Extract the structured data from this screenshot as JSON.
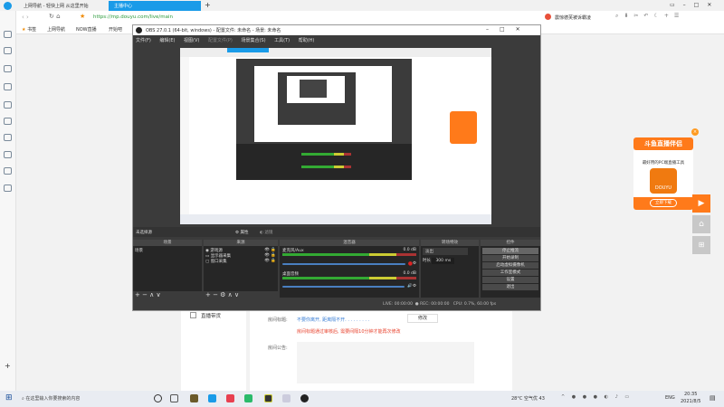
{
  "browser": {
    "tabs": [
      {
        "label": "上网导航 - 轻快上网 从这里开始",
        "active": false
      },
      {
        "label": "主播中心",
        "active": true
      }
    ],
    "url": "https://mp.douyu.com/live/main",
    "bookmarks": [
      "书签",
      "上网导航",
      "NOW直播",
      "开始吧"
    ],
    "hot_search": "震惊德芙被诉霸凌"
  },
  "page": {
    "nav_item": "直播带货",
    "title_label": "房间标题:",
    "title_value": "不要你离开, 距离隔不开. . . . . . . . .",
    "edit_button": "修改",
    "title_note": "房间标题通过审核后, 需要间隔10分钟才能再次修改",
    "notice_label": "房间公告:"
  },
  "ad": {
    "title": "斗鱼直播伴侣",
    "subtitle": "最好用的PC端直播工具",
    "logo": "DOUYU",
    "download": "立即下载"
  },
  "obs": {
    "title": "OBS 27.0.1 (64-bit, windows) - 配置文件: 未命名 - 场景: 未命名",
    "menu": [
      "文件(F)",
      "编辑(E)",
      "视图(V)",
      "配置文件(P)",
      "场景集合(S)",
      "工具(T)",
      "帮助(H)"
    ],
    "no_source": "未选择源",
    "properties": "属性",
    "filters": "滤镜",
    "docks": {
      "scenes": "场景",
      "sources": "来源",
      "mixer": "混音器",
      "transitions": "转场特效",
      "controls": "控件"
    },
    "scenes": [
      "场景"
    ],
    "sources": [
      "游戏源",
      "显示器采集",
      "窗口采集"
    ],
    "mixer": [
      {
        "name": "麦克风/Aux",
        "db": "0.0 dB"
      },
      {
        "name": "桌面音频",
        "db": "0.0 dB"
      }
    ],
    "transition": {
      "type": "淡出",
      "duration_label": "时长",
      "duration": "300 ms"
    },
    "controls": [
      "停止推流",
      "开始录制",
      "启动虚拟摄像机",
      "工作室模式",
      "设置",
      "退出"
    ],
    "status": {
      "live_label": "LIVE:",
      "live_time": "00:00:00",
      "rec_label": "REC:",
      "rec_time": "00:00:00",
      "cpu": "CPU: 0.7%, 60.00 fps"
    }
  },
  "taskbar": {
    "search_placeholder": "在这里输入你要搜索的内容",
    "weather": "28°C 空气优 43",
    "lang": "ENG",
    "time": "20:35",
    "date": "2021/8/5"
  },
  "colors": {
    "accent": "#ff7a1a",
    "obs_bg": "#3b3b3b",
    "link": "#3b7fd6",
    "warning": "#e8412c"
  }
}
